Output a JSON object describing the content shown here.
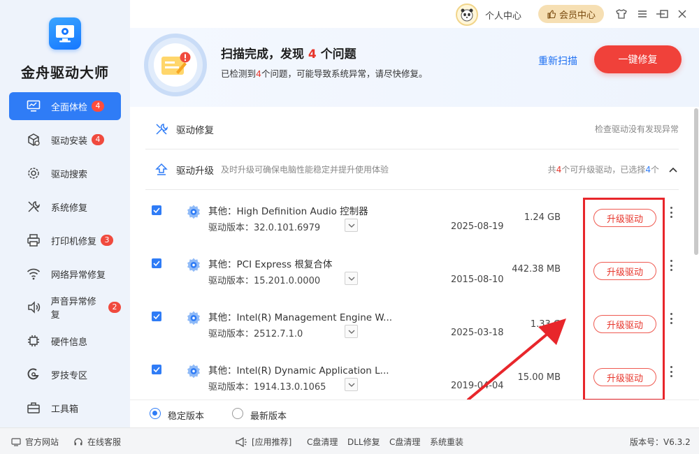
{
  "app": {
    "title": "金舟驱动大师"
  },
  "colors": {
    "accent": "#2f7cf6",
    "danger": "#f0413a",
    "sidebar_bg": "#eef3fb"
  },
  "sidebar": {
    "items": [
      {
        "label": "全面体检",
        "badge": "4",
        "icon": "monitor-icon",
        "active": true
      },
      {
        "label": "驱动安装",
        "badge": "4",
        "icon": "package-icon"
      },
      {
        "label": "驱动搜索",
        "badge": "",
        "icon": "search-gear-icon"
      },
      {
        "label": "系统修复",
        "badge": "",
        "icon": "wrench-icon"
      },
      {
        "label": "打印机修复",
        "badge": "3",
        "icon": "printer-icon"
      },
      {
        "label": "网络异常修复",
        "badge": "",
        "icon": "wifi-icon"
      },
      {
        "label": "声音异常修复",
        "badge": "2",
        "icon": "speaker-icon"
      },
      {
        "label": "硬件信息",
        "badge": "",
        "icon": "chip-icon"
      },
      {
        "label": "罗技专区",
        "badge": "",
        "icon": "logitech-icon"
      },
      {
        "label": "工具箱",
        "badge": "",
        "icon": "toolbox-icon"
      }
    ]
  },
  "topbar": {
    "personal_center": "个人中心",
    "member_center": "会员中心"
  },
  "header": {
    "title_prefix": "扫描完成，发现",
    "issue_count": "4",
    "title_suffix": "个问题",
    "sub_prefix": "已检测到",
    "sub_count": "4",
    "sub_suffix": "个问题，可能导致系统异常，请尽快修复。",
    "rescan": "重新扫描",
    "fix_all": "一键修复"
  },
  "sections": {
    "repair": {
      "title": "驱动修复",
      "status": "检查驱动没有发现异常"
    },
    "upgrade": {
      "title": "驱动升级",
      "desc": "及时升级可确保电脑性能稳定并提升使用体验",
      "total_prefix": "共",
      "total": "4",
      "total_mid": "个可升级驱动，已选择",
      "selected": "4",
      "selected_suffix": "个"
    }
  },
  "drivers": [
    {
      "name": "其他：High Definition Audio 控制器",
      "version": "驱动版本：32.0.101.6979",
      "date": "2025-08-19",
      "size": "1.24 GB",
      "action": "升级驱动"
    },
    {
      "name": "其他：PCI Express 根复合体",
      "version": "驱动版本：15.201.0.0000",
      "date": "2015-08-10",
      "size": "442.38 MB",
      "action": "升级驱动"
    },
    {
      "name": "其他：Intel(R) Management Engine W...",
      "version": "驱动版本：2512.7.1.0",
      "date": "2025-03-18",
      "size": "1.33 G",
      "action": "升级驱动"
    },
    {
      "name": "其他：Intel(R) Dynamic Application L...",
      "version": "驱动版本：1914.13.0.1065",
      "date": "2019-04-04",
      "size": "15.00 MB",
      "action": "升级驱动"
    }
  ],
  "version_options": {
    "stable": "稳定版本",
    "latest": "最新版本",
    "selected": "stable"
  },
  "footer": {
    "website": "官方网站",
    "support": "在线客服",
    "recommend": "[应用推荐]",
    "links": [
      "C盘清理",
      "DLL修复",
      "C盘清理",
      "系统重装"
    ],
    "version": "版本号：V6.3.2"
  }
}
